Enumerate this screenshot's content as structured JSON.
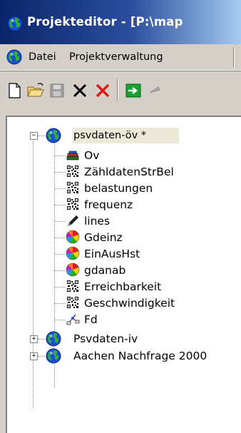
{
  "window": {
    "title": "Projekteditor - [P:\\map",
    "icon": "globe-icon"
  },
  "menu": {
    "items": [
      "Datei",
      "Projektverwaltung"
    ]
  },
  "toolbar": {
    "buttons": [
      "new-document-icon",
      "open-folder-icon",
      "save-disk-icon",
      "delete-black-x-icon",
      "delete-red-x-icon",
      "import-green-arrow-icon",
      "export-arrow-icon"
    ]
  },
  "tree": {
    "root": {
      "label": "psvdaten-öv *",
      "expander": "−",
      "children": [
        {
          "label": "Ov",
          "icon": "database-stack-icon"
        },
        {
          "label": "ZähldatenStrBel",
          "icon": "qr-table-icon"
        },
        {
          "label": "belastungen",
          "icon": "qr-table-icon"
        },
        {
          "label": "frequenz",
          "icon": "qr-table-icon"
        },
        {
          "label": "lines",
          "icon": "pen-icon"
        },
        {
          "label": "Gdeinz",
          "icon": "color-wheel-icon"
        },
        {
          "label": "EinAusHst",
          "icon": "color-wheel-icon"
        },
        {
          "label": "gdanab",
          "icon": "color-wheel-icon"
        },
        {
          "label": "Erreichbarkeit",
          "icon": "qr-table-icon"
        },
        {
          "label": "Geschwindigkeit",
          "icon": "qr-table-icon"
        },
        {
          "label": "Fd",
          "icon": "network-icon"
        }
      ]
    },
    "siblings": [
      {
        "label": "Psvdaten-iv",
        "expander": "+"
      },
      {
        "label": "Aachen Nachfrage 2000",
        "expander": "+"
      }
    ]
  }
}
